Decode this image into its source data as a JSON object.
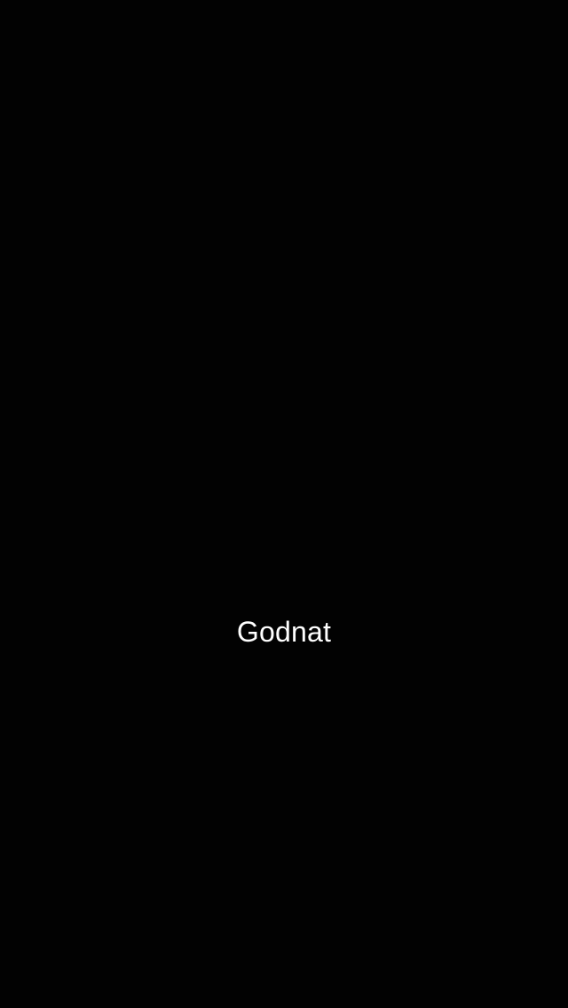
{
  "screen": {
    "background_color": "#020202",
    "message": "Godnat",
    "text_color": "#ffffff"
  }
}
